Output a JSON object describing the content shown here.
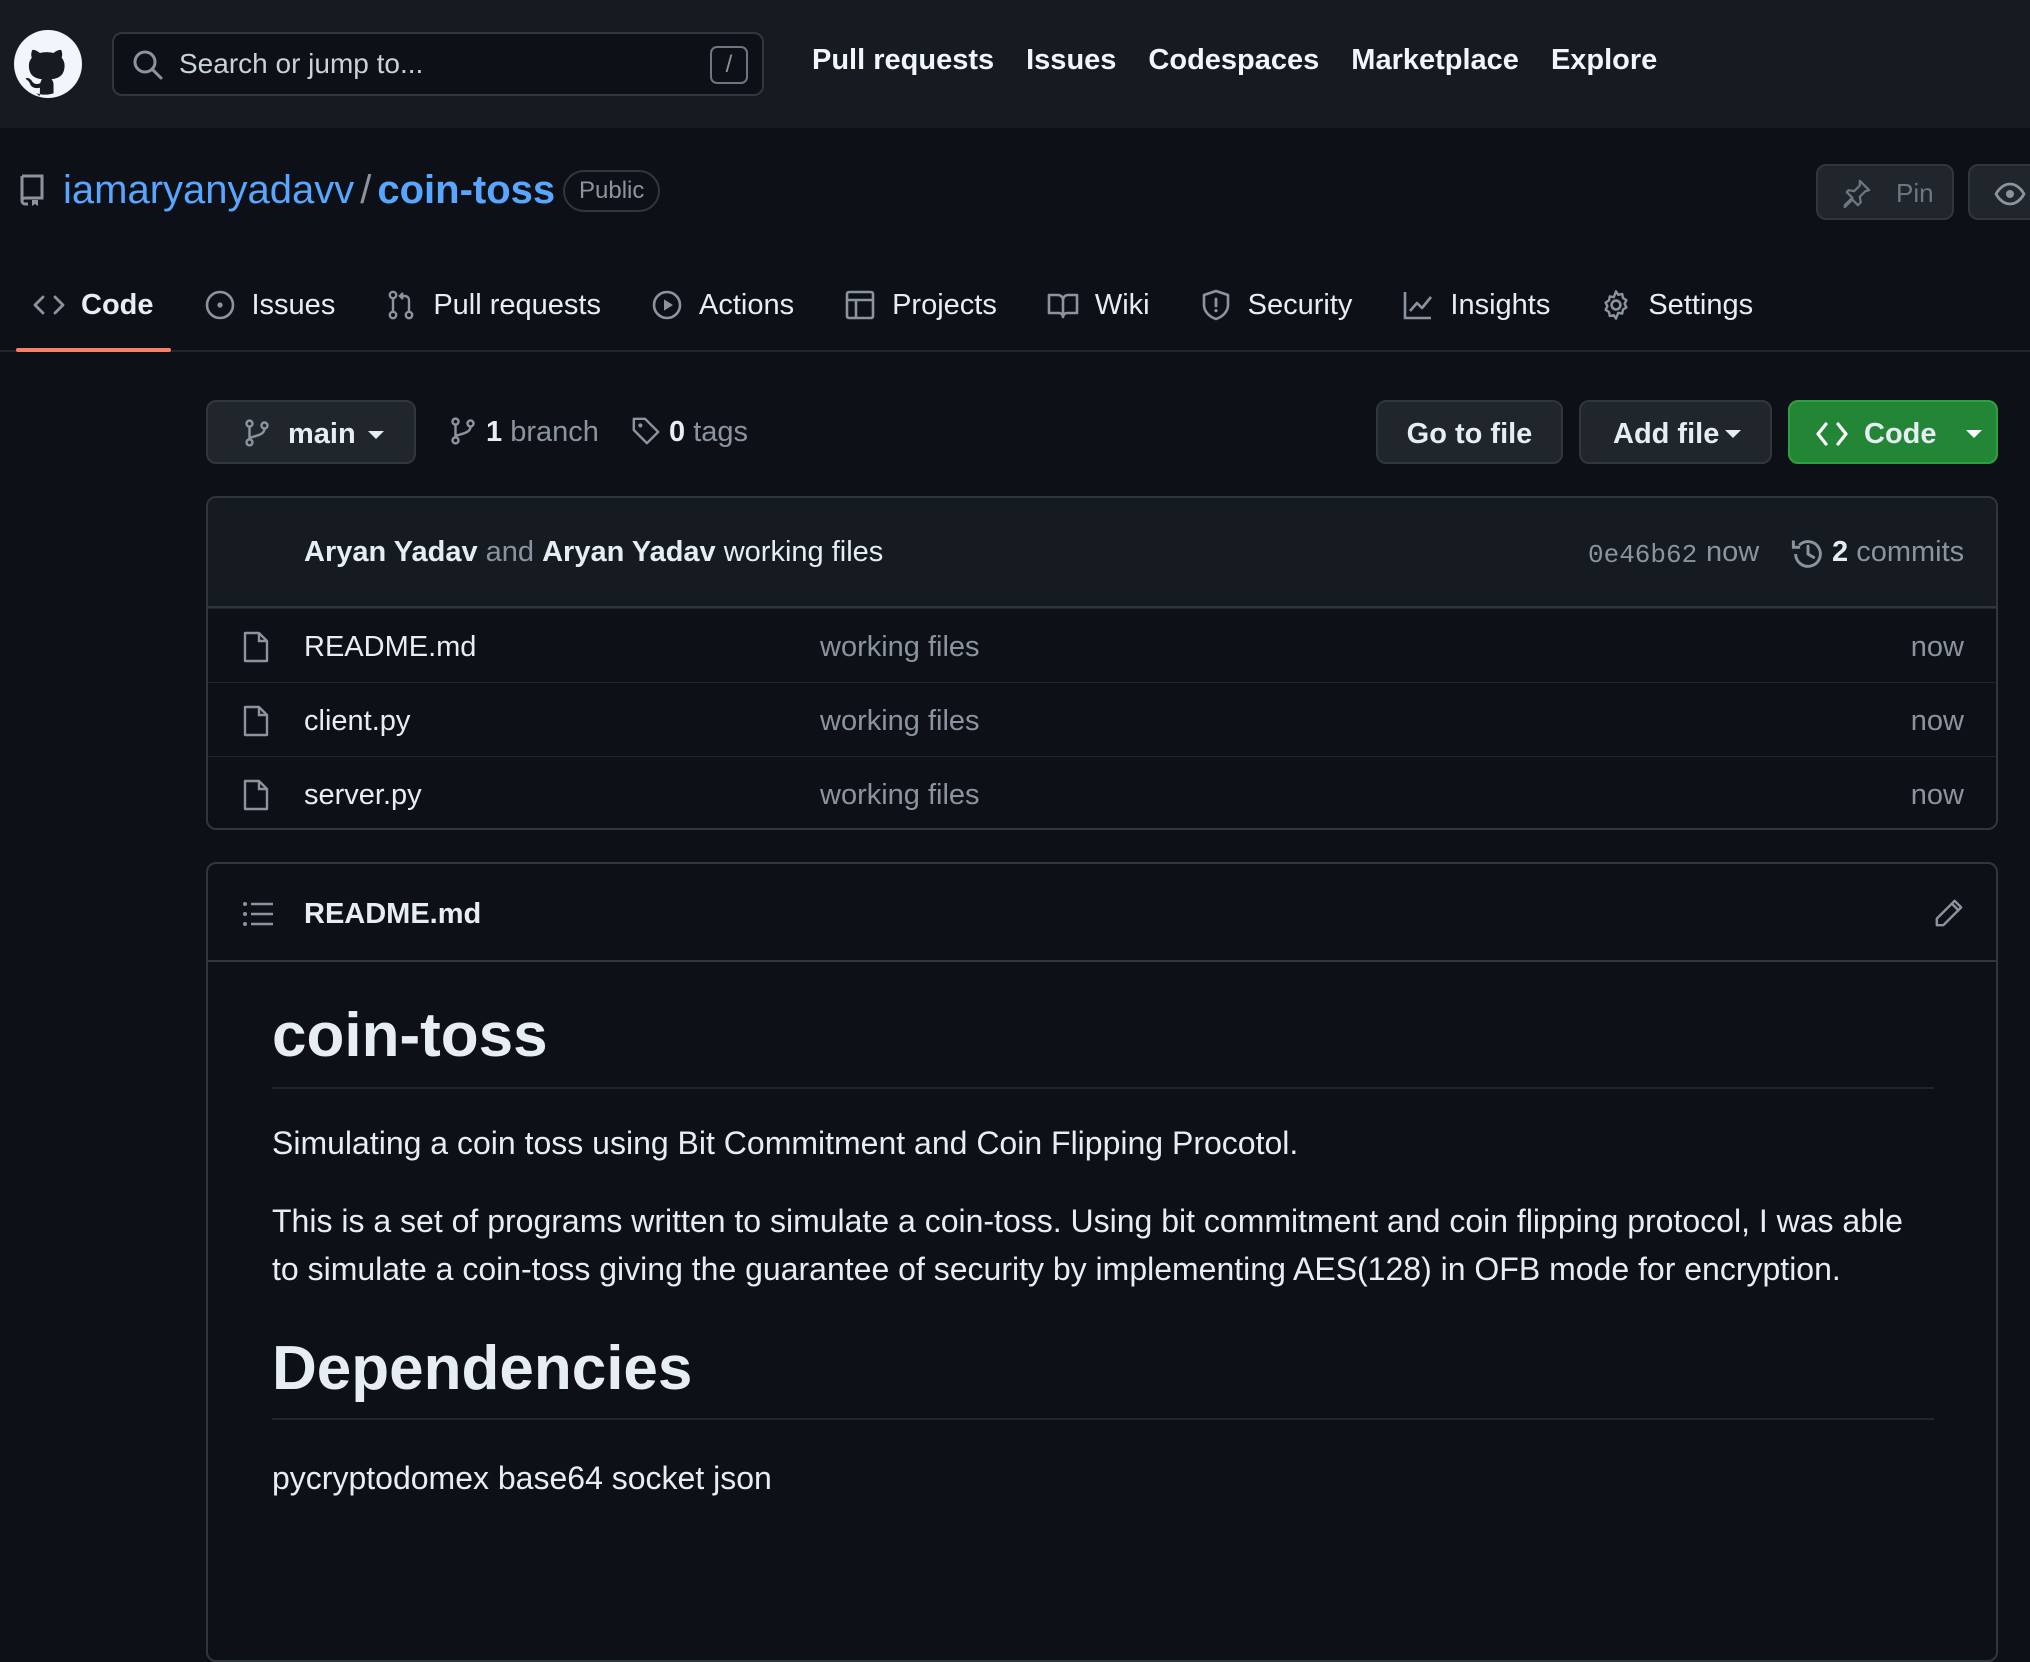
{
  "header": {
    "search_placeholder": "Search or jump to...",
    "search_shortcut": "/",
    "nav": [
      "Pull requests",
      "Issues",
      "Codespaces",
      "Marketplace",
      "Explore"
    ]
  },
  "repo": {
    "owner": "iamaryanyadavv",
    "separator": "/",
    "name": "coin-toss",
    "visibility": "Public",
    "pin_label": "Pin"
  },
  "tabs": [
    {
      "label": "Code",
      "icon": "code-icon",
      "active": true
    },
    {
      "label": "Issues",
      "icon": "issue-icon"
    },
    {
      "label": "Pull requests",
      "icon": "pull-request-icon"
    },
    {
      "label": "Actions",
      "icon": "play-icon"
    },
    {
      "label": "Projects",
      "icon": "table-icon"
    },
    {
      "label": "Wiki",
      "icon": "book-icon"
    },
    {
      "label": "Security",
      "icon": "shield-icon"
    },
    {
      "label": "Insights",
      "icon": "graph-icon"
    },
    {
      "label": "Settings",
      "icon": "gear-icon"
    }
  ],
  "toolbar": {
    "branch": "main",
    "branch_count": "1",
    "branch_word": "branch",
    "tag_count": "0",
    "tag_word": "tags",
    "go_to_file": "Go to file",
    "add_file": "Add file",
    "code": "Code"
  },
  "commit": {
    "author1": "Aryan Yadav",
    "and": "and",
    "author2": "Aryan Yadav",
    "message": "working files",
    "sha": "0e46b62",
    "time": "now",
    "count": "2",
    "count_word": "commits"
  },
  "files": [
    {
      "name": "README.md",
      "message": "working files",
      "time": "now"
    },
    {
      "name": "client.py",
      "message": "working files",
      "time": "now"
    },
    {
      "name": "server.py",
      "message": "working files",
      "time": "now"
    }
  ],
  "readme": {
    "filename": "README.md",
    "h1": "coin-toss",
    "p1": "Simulating a coin toss using Bit Commitment and Coin Flipping Procotol.",
    "p2": "This is a set of programs written to simulate a coin-toss. Using bit commitment and coin flipping protocol, I was able to simulate a coin-toss giving the guarantee of security by implementing AES(128) in OFB mode for encryption.",
    "h2": "Dependencies",
    "p3": "pycryptodomex base64 socket json"
  },
  "colors": {
    "background": "#0d1117",
    "header": "#161b22",
    "link": "#58a6ff",
    "accent_underline": "#f78166",
    "code_button": "#238636",
    "muted_text": "#8b949e"
  }
}
